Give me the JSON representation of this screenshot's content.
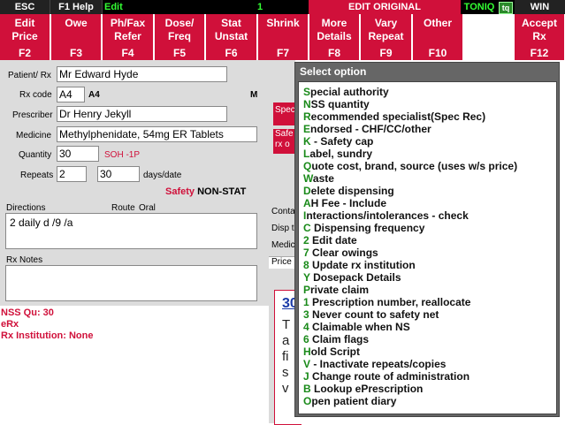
{
  "topbar": {
    "esc": "ESC",
    "help": "F1 Help",
    "mode": "Edit",
    "count": "1",
    "edit_original": "EDIT ORIGINAL",
    "toniq": "TONIQ",
    "toniq_icon": "tq",
    "win": "WIN"
  },
  "fkeys": [
    {
      "label": "Edit\nPrice",
      "key": "F2"
    },
    {
      "label": "Owe",
      "key": "F3"
    },
    {
      "label": "Ph/Fax\nRefer",
      "key": "F4"
    },
    {
      "label": "Dose/\nFreq",
      "key": "F5"
    },
    {
      "label": "Stat\nUnstat",
      "key": "F6"
    },
    {
      "label": "Shrink",
      "key": "F7"
    },
    {
      "label": "More\nDetails",
      "key": "F8"
    },
    {
      "label": "Vary\nRepeat",
      "key": "F9"
    },
    {
      "label": "Other",
      "key": "F10"
    },
    {
      "label": "Accept\nRx",
      "key": "F12"
    }
  ],
  "form": {
    "patient_label": "Patient/ Rx",
    "patient_value": "Mr Edward Hyde",
    "rxcode_label": "Rx code",
    "rxcode_value": "A4",
    "rxcode_display": "A4",
    "rxcode_flag": "M",
    "prescriber_label": "Prescriber",
    "prescriber_value": "Dr Henry Jekyll",
    "medicine_label": "Medicine",
    "medicine_value": "Methylphenidate, 54mg ER  Tablets",
    "quantity_label": "Quantity",
    "quantity_value": "30",
    "soh": "SOH -1P",
    "repeats_label": "Repeats",
    "repeats_value": "2",
    "days_value": "30",
    "days_label": "days/date",
    "safety_label": "Safety",
    "safety_value": "NON-STAT",
    "directions_label": "Directions",
    "route_label": "Route",
    "route_value": "Oral",
    "directions_value": "2 daily d /9 /a",
    "rxnotes_label": "Rx Notes"
  },
  "info": {
    "nss": "NSS Qu: 30",
    "erx": "eRx",
    "institution": "Rx Institution: None"
  },
  "mid": {
    "tag1": "Spec",
    "tag2a": "Safe",
    "tag2b": "rx o",
    "conta": "Conta",
    "disp": "Disp t",
    "medic": "Medic",
    "price": "Price",
    "box_num": "30",
    "box_text": "Ta fi sv"
  },
  "dialog": {
    "title": "Select option",
    "options": [
      {
        "key": "S",
        "rest": "pecial authority"
      },
      {
        "key": "N",
        "rest": "SS quantity"
      },
      {
        "key": "R",
        "rest": "ecommended specialist(Spec Rec)"
      },
      {
        "key": "E",
        "rest": "ndorsed - CHF/CC/other"
      },
      {
        "key": "K",
        "rest": " - Safety cap"
      },
      {
        "key": "L",
        "rest": "abel, sundry"
      },
      {
        "key": "Q",
        "rest": "uote cost, brand, source (uses w/s price)"
      },
      {
        "key": "W",
        "rest": "aste"
      },
      {
        "key": "D",
        "rest": "elete dispensing"
      },
      {
        "key": "A",
        "rest": "H Fee - Include"
      },
      {
        "key": "I",
        "rest": "nteractions/intolerances - check"
      },
      {
        "key": "C",
        "rest": " Dispensing frequency"
      },
      {
        "key": "2",
        "rest": " Edit date"
      },
      {
        "key": "7",
        "rest": " Clear owings"
      },
      {
        "key": "8",
        "rest": " Update rx institution"
      },
      {
        "key": "Y",
        "rest": " Dosepack Details"
      },
      {
        "key": "P",
        "rest": "rivate claim"
      },
      {
        "key": "1",
        "rest": " Prescription number, reallocate"
      },
      {
        "key": "3",
        "rest": " Never count to safety net"
      },
      {
        "key": "4",
        "rest": " Claimable when NS"
      },
      {
        "key": "6",
        "rest": " Claim flags"
      },
      {
        "key": "H",
        "rest": "old Script"
      },
      {
        "key": "V",
        "rest": " - Inactivate repeats/copies"
      },
      {
        "key": "J",
        "rest": " Change route of administration"
      },
      {
        "key": "B",
        "rest": " Lookup ePrescription"
      },
      {
        "key": "O",
        "rest": "pen patient diary"
      }
    ]
  }
}
